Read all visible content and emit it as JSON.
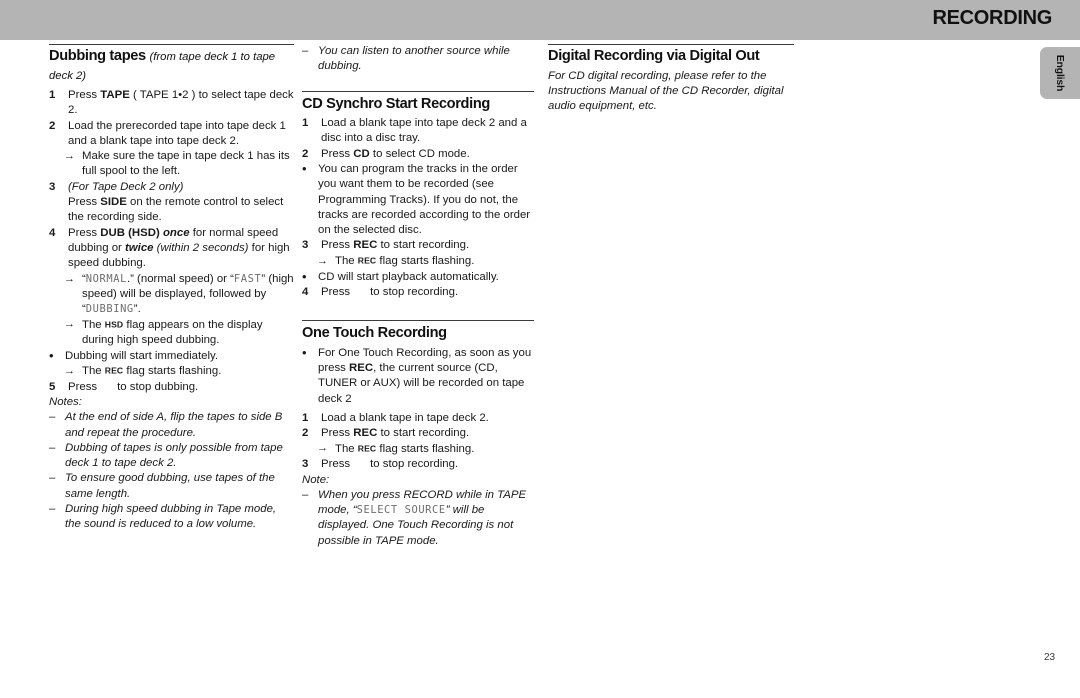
{
  "header": {
    "title": "RECORDING",
    "bar_color": "#b4b4b4"
  },
  "language_tab": {
    "label": "English"
  },
  "page_number": "23",
  "columns": [
    {
      "id": "column-1",
      "blocks": [
        {
          "type": "heading",
          "text": "Dubbing tapes ",
          "sub": "(from tape deck 1 to tape deck 2)",
          "rule_above": true
        },
        {
          "type": "step",
          "marker": "1",
          "parts": [
            {
              "t": "Press "
            },
            {
              "t": "TAPE",
              "s": "b"
            },
            {
              "t": " ( TAPE 1•2 ) to select tape deck 2."
            }
          ]
        },
        {
          "type": "step",
          "marker": "2",
          "parts": [
            {
              "t": "Load the prerecorded tape into tape deck 1 and a blank tape into tape deck 2."
            }
          ]
        },
        {
          "type": "arrow",
          "marker": "→",
          "parts": [
            {
              "t": "Make sure the tape in tape deck 1 has its full spool to the left."
            }
          ]
        },
        {
          "type": "step",
          "marker": "3",
          "parts": [
            {
              "t": "(For Tape Deck 2 only)",
              "s": "i"
            }
          ]
        },
        {
          "type": "cont",
          "parts": [
            {
              "t": "Press "
            },
            {
              "t": "SIDE",
              "s": "b"
            },
            {
              "t": " on the remote control to select the recording side."
            }
          ]
        },
        {
          "type": "step",
          "marker": "4",
          "parts": [
            {
              "t": "Press "
            },
            {
              "t": "DUB (HSD)",
              "s": "b"
            },
            {
              "t": " "
            },
            {
              "t": "once",
              "s": "bi"
            },
            {
              "t": " for normal speed dubbing or "
            },
            {
              "t": "twice",
              "s": "bi"
            },
            {
              "t": " "
            },
            {
              "t": "(within 2 seconds)",
              "s": "i"
            },
            {
              "t": " for high speed dubbing."
            }
          ]
        },
        {
          "type": "arrow",
          "marker": "→",
          "parts": [
            {
              "t": "“"
            },
            {
              "t": "NORMAL",
              "s": "lcd"
            },
            {
              "t": ".” (normal speed) or “"
            },
            {
              "t": "FAST",
              "s": "lcd"
            },
            {
              "t": "” (high speed) will be displayed, followed by "
            },
            {
              "t": "“"
            },
            {
              "t": "DUBBING",
              "s": "lcd"
            },
            {
              "t": "”."
            }
          ]
        },
        {
          "type": "arrow",
          "marker": "→",
          "parts": [
            {
              "t": "The "
            },
            {
              "t": "HSD",
              "s": "flag"
            },
            {
              "t": " flag appears on the display during high speed dubbing."
            }
          ]
        },
        {
          "type": "bullet",
          "marker": "•",
          "parts": [
            {
              "t": "Dubbing will start immediately."
            }
          ]
        },
        {
          "type": "arrow",
          "marker": "→",
          "parts": [
            {
              "t": "The "
            },
            {
              "t": "REC",
              "s": "flag"
            },
            {
              "t": " flag starts flashing."
            }
          ]
        },
        {
          "type": "step",
          "marker": "5",
          "parts": [
            {
              "t": "Press"
            },
            {
              "t": "",
              "s": "gap"
            },
            {
              "t": "to stop dubbing."
            }
          ]
        },
        {
          "type": "notes-label",
          "text": "Notes:",
          "spaced": true
        },
        {
          "type": "dash",
          "marker": "–",
          "parts": [
            {
              "t": "At the end of side A, flip the tapes to side B and repeat the procedure.",
              "s": "i"
            }
          ]
        },
        {
          "type": "dash",
          "marker": "–",
          "parts": [
            {
              "t": "Dubbing of tapes is only possible from tape deck 1 to tape deck 2.",
              "s": "i"
            }
          ]
        },
        {
          "type": "dash",
          "marker": "–",
          "parts": [
            {
              "t": "To ensure good dubbing, use tapes of the same length.",
              "s": "i"
            }
          ]
        },
        {
          "type": "dash",
          "marker": "–",
          "parts": [
            {
              "t": "During high speed dubbing in Tape mode, the sound is reduced to a low volume.",
              "s": "i"
            }
          ]
        }
      ]
    },
    {
      "id": "column-2",
      "blocks": [
        {
          "type": "dash",
          "marker": "–",
          "parts": [
            {
              "t": "You can listen to another source while dubbing.",
              "s": "i"
            }
          ]
        },
        {
          "type": "heading",
          "text": "CD Synchro Start Recording",
          "sub": "",
          "rule_above": true,
          "spaced": true
        },
        {
          "type": "step",
          "marker": "1",
          "parts": [
            {
              "t": "Load a blank tape into tape deck 2 and a disc into a disc tray."
            }
          ]
        },
        {
          "type": "step",
          "marker": "2",
          "parts": [
            {
              "t": "Press "
            },
            {
              "t": "CD",
              "s": "b"
            },
            {
              "t": " to select CD mode."
            }
          ]
        },
        {
          "type": "bullet",
          "marker": "•",
          "parts": [
            {
              "t": "You can program the tracks in the order you want them to be recorded (see Programming Tracks).  If you do not, the tracks are recorded according to the order on the selected disc."
            }
          ]
        },
        {
          "type": "step",
          "marker": "3",
          "parts": [
            {
              "t": "Press "
            },
            {
              "t": "REC",
              "s": "b"
            },
            {
              "t": " to start recording."
            }
          ]
        },
        {
          "type": "arrow",
          "marker": "→",
          "parts": [
            {
              "t": "The "
            },
            {
              "t": "REC",
              "s": "flag"
            },
            {
              "t": " flag starts flashing."
            }
          ]
        },
        {
          "type": "bullet",
          "marker": "•",
          "parts": [
            {
              "t": "CD will start playback automatically."
            }
          ]
        },
        {
          "type": "step",
          "marker": "4",
          "parts": [
            {
              "t": "Press"
            },
            {
              "t": "",
              "s": "gap"
            },
            {
              "t": "to stop recording."
            }
          ]
        },
        {
          "type": "heading",
          "text": "One Touch Recording",
          "sub": "",
          "rule_above": true,
          "spaced": true,
          "extra_space": true
        },
        {
          "type": "bullet",
          "marker": "•",
          "parts": [
            {
              "t": "For One Touch Recording, as soon as you press "
            },
            {
              "t": "REC",
              "s": "b"
            },
            {
              "t": ", the current source (CD, TUNER or AUX) will be recorded on tape deck 2"
            }
          ]
        },
        {
          "type": "step",
          "marker": "1",
          "spaced": true,
          "parts": [
            {
              "t": "Load a blank tape in tape deck 2."
            }
          ]
        },
        {
          "type": "step",
          "marker": "2",
          "parts": [
            {
              "t": "Press "
            },
            {
              "t": "REC",
              "s": "b"
            },
            {
              "t": " to start recording."
            }
          ]
        },
        {
          "type": "arrow",
          "marker": "→",
          "parts": [
            {
              "t": "The "
            },
            {
              "t": "REC",
              "s": "flag"
            },
            {
              "t": " flag starts flashing."
            }
          ]
        },
        {
          "type": "step",
          "marker": "3",
          "parts": [
            {
              "t": "Press"
            },
            {
              "t": "",
              "s": "gap"
            },
            {
              "t": "to stop recording."
            }
          ]
        },
        {
          "type": "notes-label",
          "text": "Note:",
          "spaced": true
        },
        {
          "type": "dash",
          "marker": "–",
          "parts": [
            {
              "t": "When you press RECORD while in TAPE mode, “",
              "s": "i"
            },
            {
              "t": "SELECT SOURCE",
              "s": "lcd"
            },
            {
              "t": "” will be displayed.  One Touch Recording is not possible in TAPE mode.",
              "s": "i"
            }
          ]
        }
      ]
    },
    {
      "id": "column-3",
      "blocks": [
        {
          "type": "heading",
          "text": "Digital Recording via Digital Out",
          "sub": "",
          "rule_above": true
        },
        {
          "type": "para",
          "italic": true,
          "text": "For CD digital recording, please refer to the Instructions Manual of the CD Recorder, digital audio equipment, etc."
        }
      ]
    }
  ]
}
